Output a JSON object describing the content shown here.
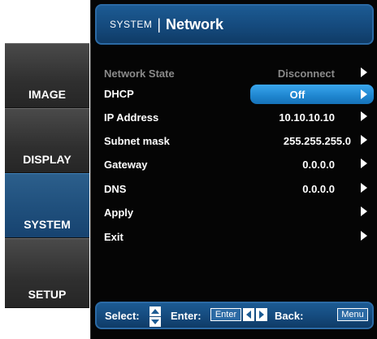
{
  "tabs": [
    {
      "label": "IMAGE",
      "active": false
    },
    {
      "label": "DISPLAY",
      "active": false
    },
    {
      "label": "SYSTEM",
      "active": true
    },
    {
      "label": "SETUP",
      "active": false
    }
  ],
  "header": {
    "category": "SYSTEM",
    "separator": "|",
    "title": "Network"
  },
  "rows": [
    {
      "label": "Network State",
      "value": "Disconnect"
    },
    {
      "label": "DHCP",
      "value": "Off"
    },
    {
      "label": "IP Address",
      "value": "10.10.10.10"
    },
    {
      "label": "Subnet mask",
      "value": "255.255.255.0"
    },
    {
      "label": "Gateway",
      "value": "0.0.0.0"
    },
    {
      "label": "DNS",
      "value": "0.0.0.0"
    },
    {
      "label": "Apply",
      "value": ""
    },
    {
      "label": "Exit",
      "value": ""
    }
  ],
  "footer": {
    "select_label": "Select:",
    "enter_label": "Enter:",
    "enter_key": "Enter",
    "back_label": "Back:",
    "menu_key": "Menu"
  },
  "colors": {
    "accent": "#1e85cf",
    "title_bar": "#154a7d",
    "active_tab": "#1f4f7c"
  }
}
